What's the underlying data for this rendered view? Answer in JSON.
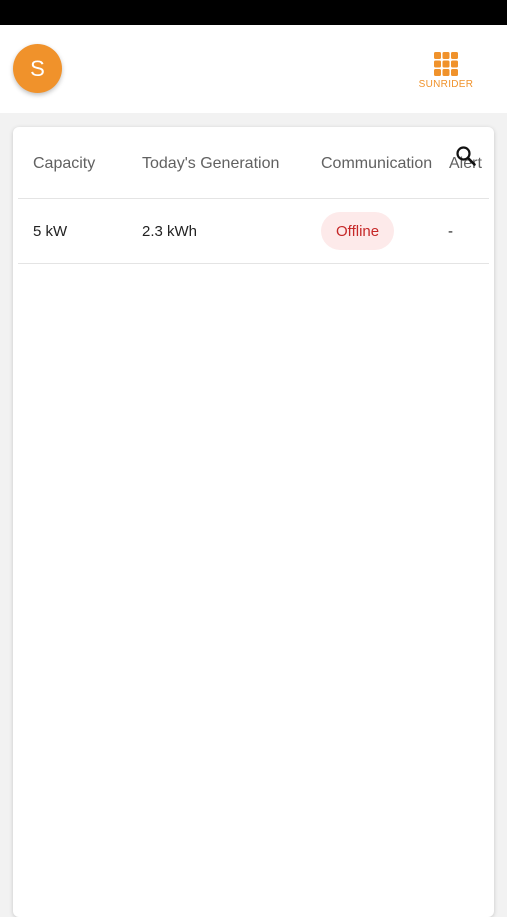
{
  "header": {
    "avatar_initial": "S",
    "brand_name": "SUNRIDER",
    "accent_color": "#f0922b"
  },
  "table": {
    "search_icon": "search-icon",
    "columns": [
      "Capacity",
      "Today's Generation",
      "Communication",
      "Alert"
    ],
    "rows": [
      {
        "capacity": "5 kW",
        "todays_generation": "2.3 kWh",
        "communication": "Offline",
        "alert": "-"
      }
    ],
    "status_colors": {
      "offline_text": "#c62828",
      "offline_bg": "#fdeaea"
    }
  }
}
